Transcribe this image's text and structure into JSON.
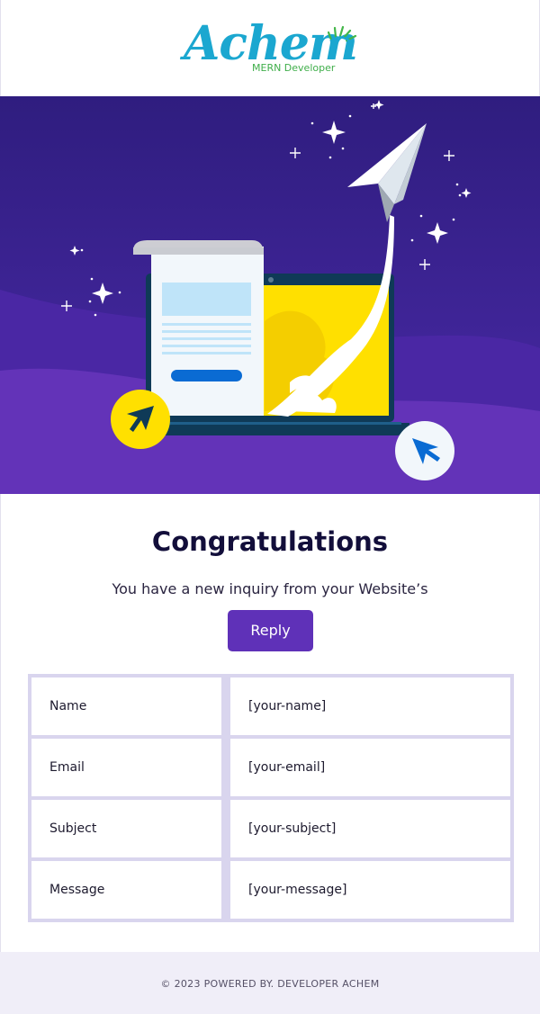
{
  "brand": {
    "logo_text": "Achem",
    "tagline": "MERN Developer"
  },
  "hero": {
    "illustration": "paper-plane-launch-from-laptop",
    "colors": {
      "bg_top": "#2f1d7f",
      "bg_bottom": "#6333b8",
      "screen": "#ffe000",
      "laptop": "#0f3a57",
      "accent_blue": "#0a6bd3"
    }
  },
  "main": {
    "title": "Congratulations",
    "subtitle": "You have a new inquiry from your Website’s",
    "reply_label": "Reply",
    "accent": "#5f31b8"
  },
  "table": {
    "rows": [
      {
        "label": "Name",
        "value": "[your-name]"
      },
      {
        "label": "Email",
        "value": "[your-email]"
      },
      {
        "label": "Subject",
        "value": "[your-subject]"
      },
      {
        "label": "Message",
        "value": "[your-message]"
      }
    ]
  },
  "footer": {
    "text": "© 2023 POWERED BY. DEVELOPER ACHEM"
  }
}
